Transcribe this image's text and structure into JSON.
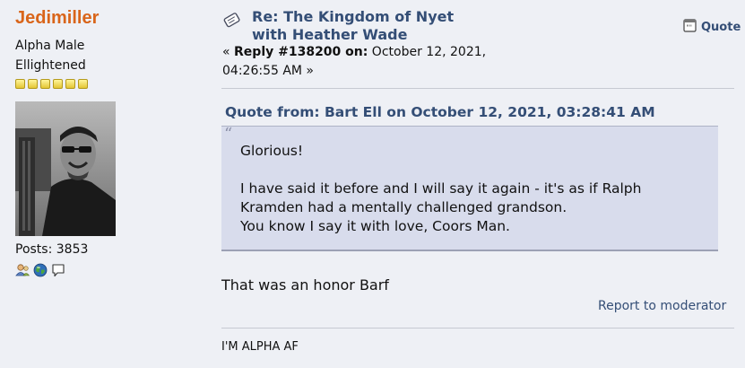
{
  "user": {
    "name": "Jedimiller",
    "title": "Alpha Male",
    "group": "Ellightened",
    "star_count": 6,
    "posts_label": "Posts: 3853"
  },
  "post": {
    "subject_line1": "Re: The Kingdom of Nyet",
    "subject_line2": "with Heather Wade",
    "quote_button": "Quote",
    "meta_prefix": "« ",
    "reply_label": "Reply #138200 on:",
    "date": " October 12, 2021,",
    "time": "04:26:55 AM »",
    "quote_header": "Quote from: Bart Ell on October 12, 2021, 03:28:41 AM",
    "quote_lines": [
      "Glorious!",
      "",
      "I have said it before and I will say it again - it's as if Ralph",
      "Kramden had a mentally challenged grandson.",
      "You know I say it with love, Coors Man."
    ],
    "body": "That was an honor Barf",
    "report_link": "Report to moderator",
    "signature": "I'M ALPHA AF"
  },
  "colors": {
    "username": "#d9651a",
    "link": "#344e76",
    "quote_bg": "#d8dcec",
    "page_bg": "#eef0f5"
  },
  "icons": [
    "post-subject-icon",
    "quote-icon",
    "profile-icon",
    "website-icon",
    "personal-message-icon",
    "rank-star-icon"
  ]
}
